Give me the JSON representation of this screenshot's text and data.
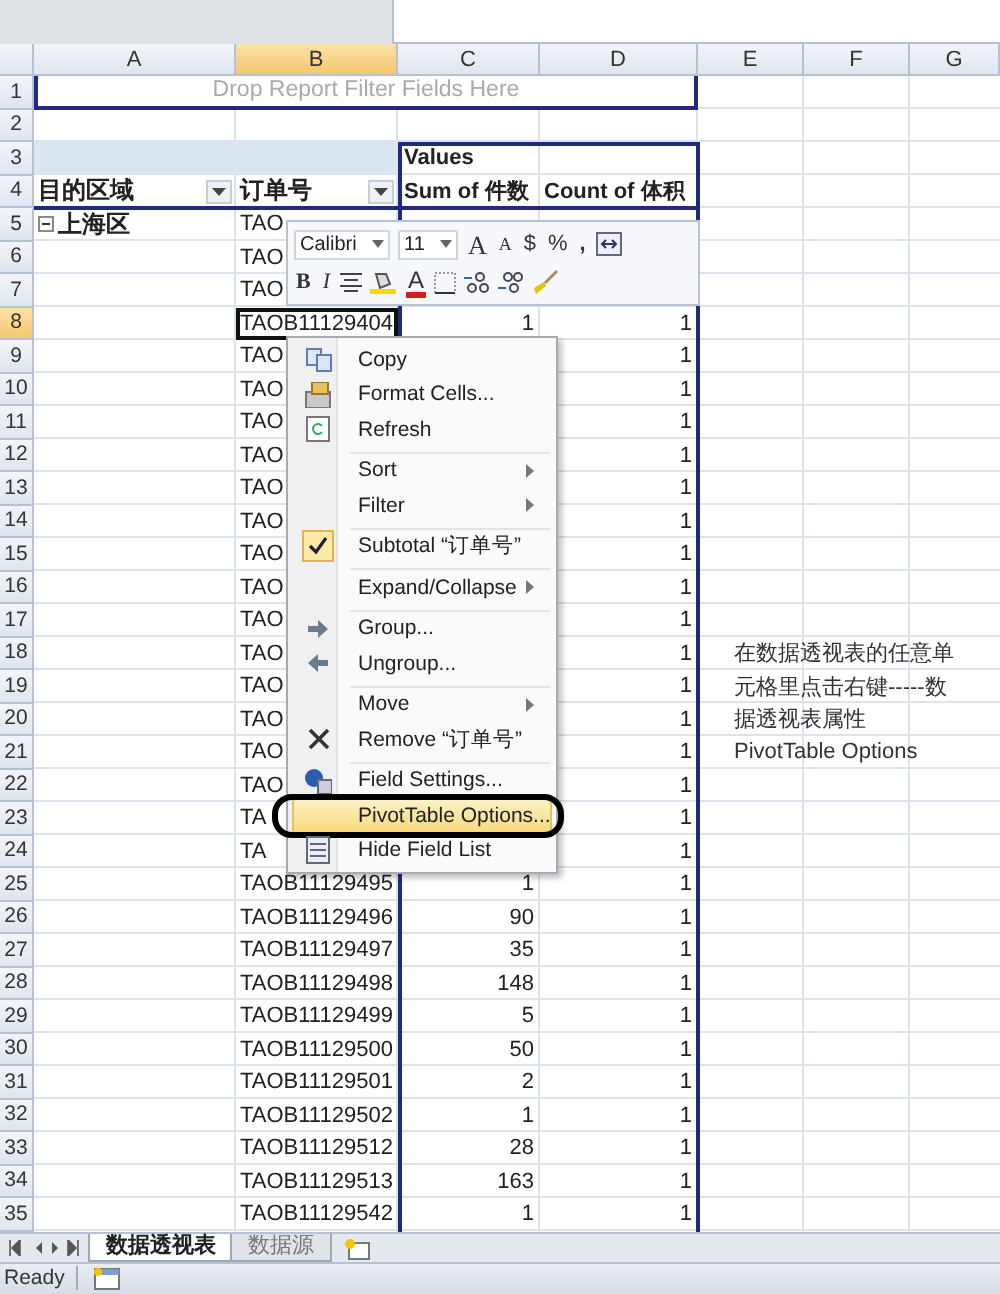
{
  "columns": [
    {
      "label": "A",
      "selected": false
    },
    {
      "label": "B",
      "selected": true
    },
    {
      "label": "C",
      "selected": false
    },
    {
      "label": "D",
      "selected": false
    },
    {
      "label": "E",
      "selected": false
    },
    {
      "label": "F",
      "selected": false
    },
    {
      "label": "G",
      "selected": false
    }
  ],
  "rows": [
    {
      "number": "1",
      "kind": "filter",
      "selected": false,
      "text": "Drop Report Filter Fields Here"
    },
    {
      "number": "2",
      "kind": "blank",
      "selected": false
    },
    {
      "number": "3",
      "kind": "values_header",
      "selected": false,
      "c": "Values"
    },
    {
      "number": "4",
      "kind": "field_header",
      "selected": false,
      "a": "目的区域",
      "b": "订单号",
      "c": "Sum of 件数",
      "d": "Count of 体积"
    },
    {
      "number": "5",
      "kind": "group",
      "selected": false,
      "a": "上海区",
      "b": "TAO"
    },
    {
      "number": "6",
      "kind": "data",
      "selected": false,
      "b": "TAO"
    },
    {
      "number": "7",
      "kind": "data",
      "selected": false,
      "b": "TAO"
    },
    {
      "number": "8",
      "kind": "data",
      "selected": true,
      "b": "TAOB11129404",
      "c": "1",
      "d": "1"
    },
    {
      "number": "9",
      "kind": "data",
      "selected": false,
      "b": "TAO",
      "d": "1"
    },
    {
      "number": "10",
      "kind": "data",
      "selected": false,
      "b": "TAO",
      "d": "1"
    },
    {
      "number": "11",
      "kind": "data",
      "selected": false,
      "b": "TAO",
      "d": "1"
    },
    {
      "number": "12",
      "kind": "data",
      "selected": false,
      "b": "TAO",
      "d": "1"
    },
    {
      "number": "13",
      "kind": "data",
      "selected": false,
      "b": "TAO",
      "d": "1"
    },
    {
      "number": "14",
      "kind": "data",
      "selected": false,
      "b": "TAO",
      "d": "1"
    },
    {
      "number": "15",
      "kind": "data",
      "selected": false,
      "b": "TAO",
      "d": "1"
    },
    {
      "number": "16",
      "kind": "data",
      "selected": false,
      "b": "TAO",
      "d": "1"
    },
    {
      "number": "17",
      "kind": "data",
      "selected": false,
      "b": "TAO",
      "d": "1"
    },
    {
      "number": "18",
      "kind": "data",
      "selected": false,
      "b": "TAO",
      "d": "1",
      "e": "在数据透视表的任意单"
    },
    {
      "number": "19",
      "kind": "data",
      "selected": false,
      "b": "TAO",
      "d": "1",
      "e": "元格里点击右键-----数"
    },
    {
      "number": "20",
      "kind": "data",
      "selected": false,
      "b": "TAO",
      "d": "1",
      "e": "据透视表属性"
    },
    {
      "number": "21",
      "kind": "data",
      "selected": false,
      "b": "TAO",
      "d": "1",
      "e": "PivotTable Options"
    },
    {
      "number": "22",
      "kind": "data",
      "selected": false,
      "b": "TAO",
      "d": "1"
    },
    {
      "number": "23",
      "kind": "data",
      "selected": false,
      "b": "TA",
      "d": "1"
    },
    {
      "number": "24",
      "kind": "data",
      "selected": false,
      "b": "TA",
      "d": "1"
    },
    {
      "number": "25",
      "kind": "data",
      "selected": false,
      "b": "TAOB11129495",
      "c": "1",
      "d": "1"
    },
    {
      "number": "26",
      "kind": "data",
      "selected": false,
      "b": "TAOB11129496",
      "c": "90",
      "d": "1"
    },
    {
      "number": "27",
      "kind": "data",
      "selected": false,
      "b": "TAOB11129497",
      "c": "35",
      "d": "1"
    },
    {
      "number": "28",
      "kind": "data",
      "selected": false,
      "b": "TAOB11129498",
      "c": "148",
      "d": "1"
    },
    {
      "number": "29",
      "kind": "data",
      "selected": false,
      "b": "TAOB11129499",
      "c": "5",
      "d": "1"
    },
    {
      "number": "30",
      "kind": "data",
      "selected": false,
      "b": "TAOB11129500",
      "c": "50",
      "d": "1"
    },
    {
      "number": "31",
      "kind": "data",
      "selected": false,
      "b": "TAOB11129501",
      "c": "2",
      "d": "1"
    },
    {
      "number": "32",
      "kind": "data",
      "selected": false,
      "b": "TAOB11129502",
      "c": "1",
      "d": "1"
    },
    {
      "number": "33",
      "kind": "data",
      "selected": false,
      "b": "TAOB11129512",
      "c": "28",
      "d": "1"
    },
    {
      "number": "34",
      "kind": "data",
      "selected": false,
      "b": "TAOB11129513",
      "c": "163",
      "d": "1"
    },
    {
      "number": "35",
      "kind": "data",
      "selected": false,
      "b": "TAOB11129542",
      "c": "1",
      "d": "1"
    }
  ],
  "mini_toolbar": {
    "font": "Calibri",
    "size": "11",
    "grow_label": "A",
    "shrink_label": "A",
    "currency_label": "$",
    "percent_label": "%",
    "comma_label": ",",
    "bold_label": "B",
    "italic_label": "I",
    "font_color_label": "A"
  },
  "context_menu": [
    {
      "label": "Copy",
      "submenu": false,
      "checked": false,
      "selected": false,
      "separator_before": false
    },
    {
      "label": "Format Cells...",
      "submenu": false,
      "checked": false,
      "selected": false,
      "separator_before": false
    },
    {
      "label": "Refresh",
      "submenu": false,
      "checked": false,
      "selected": false,
      "separator_before": false
    },
    {
      "label": "Sort",
      "submenu": true,
      "checked": false,
      "selected": false,
      "separator_before": true
    },
    {
      "label": "Filter",
      "submenu": true,
      "checked": false,
      "selected": false,
      "separator_before": false
    },
    {
      "label": "Subtotal “订单号”",
      "submenu": false,
      "checked": true,
      "selected": false,
      "separator_before": true
    },
    {
      "label": "Expand/Collapse",
      "submenu": true,
      "checked": false,
      "selected": false,
      "separator_before": true
    },
    {
      "label": "Group...",
      "submenu": false,
      "checked": false,
      "selected": false,
      "separator_before": true
    },
    {
      "label": "Ungroup...",
      "submenu": false,
      "checked": false,
      "selected": false,
      "separator_before": false
    },
    {
      "label": "Move",
      "submenu": true,
      "checked": false,
      "selected": false,
      "separator_before": true
    },
    {
      "label": "Remove “订单号”",
      "submenu": false,
      "checked": false,
      "selected": false,
      "separator_before": false
    },
    {
      "label": "Field Settings...",
      "submenu": false,
      "checked": false,
      "selected": false,
      "separator_before": true
    },
    {
      "label": "PivotTable Options...",
      "submenu": false,
      "checked": false,
      "selected": true,
      "separator_before": false
    },
    {
      "label": "Hide Field List",
      "submenu": false,
      "checked": false,
      "selected": false,
      "separator_before": false
    }
  ],
  "sheet_tabs": [
    {
      "label": "数据透视表",
      "selected": true
    },
    {
      "label": "数据源",
      "selected": false
    }
  ],
  "status_bar": {
    "text": "Ready"
  }
}
